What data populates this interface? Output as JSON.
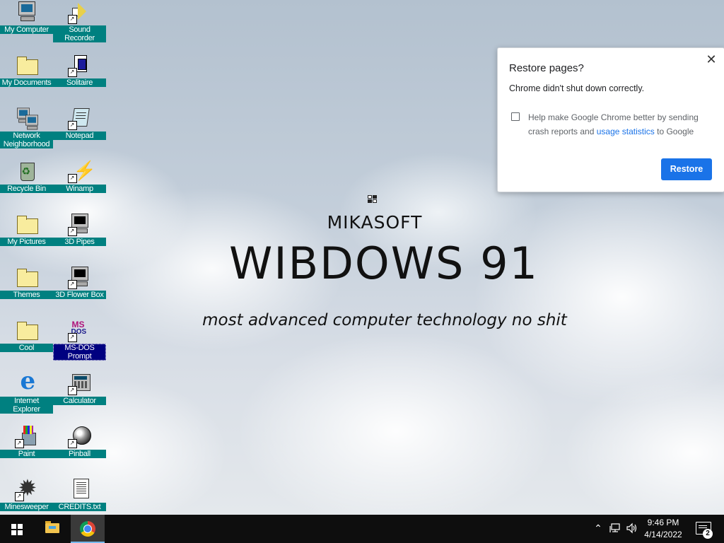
{
  "desktop": {
    "icons": [
      {
        "label": "My Computer",
        "glyph": "monitor"
      },
      {
        "label": "Sound Recorder",
        "glyph": "speaker",
        "shortcut": true
      },
      {
        "label": "My Documents",
        "glyph": "folder"
      },
      {
        "label": "Solitaire",
        "glyph": "cards",
        "shortcut": true
      },
      {
        "label": "Network Neighborhood",
        "glyph": "network"
      },
      {
        "label": "Notepad",
        "glyph": "notepad",
        "shortcut": true
      },
      {
        "label": "Recycle Bin",
        "glyph": "bin"
      },
      {
        "label": "Winamp",
        "glyph": "bolt",
        "shortcut": true
      },
      {
        "label": "My Pictures",
        "glyph": "folder"
      },
      {
        "label": "3D Pipes",
        "glyph": "monitor-dark",
        "shortcut": true
      },
      {
        "label": "Themes",
        "glyph": "folder"
      },
      {
        "label": "3D Flower Box",
        "glyph": "monitor-dark",
        "shortcut": true
      },
      {
        "label": "Cool",
        "glyph": "folder"
      },
      {
        "label": "MS-DOS Prompt",
        "glyph": "msdos",
        "shortcut": true,
        "selected": true
      },
      {
        "label": "Internet Explorer",
        "glyph": "ie"
      },
      {
        "label": "Calculator",
        "glyph": "calc",
        "shortcut": true
      },
      {
        "label": "Paint",
        "glyph": "paint",
        "shortcut": true
      },
      {
        "label": "Pinball",
        "glyph": "ball",
        "shortcut": true
      },
      {
        "label": "Minesweeper",
        "glyph": "gear",
        "shortcut": true
      },
      {
        "label": "CREDITS.txt",
        "glyph": "doc"
      }
    ],
    "brand": "MIKASOFT",
    "product": "WIBDOWS 91",
    "tagline": "most advanced computer technology no shit"
  },
  "dialog": {
    "title": "Restore pages?",
    "message": "Chrome didn't shut down correctly.",
    "checkbox_text_1": "Help make Google Chrome better by sending crash reports and",
    "checkbox_link": "usage statistics",
    "checkbox_text_2": "to Google",
    "checked": false,
    "restore_label": "Restore",
    "close_icon": "close-icon"
  },
  "taskbar": {
    "start_icon": "windows-logo-icon",
    "apps": [
      {
        "name": "File Explorer",
        "icon": "file-explorer-icon",
        "active": false
      },
      {
        "name": "Google Chrome",
        "icon": "chrome-icon",
        "active": true
      }
    ],
    "tray_icons": [
      "chevron-up-icon",
      "network-icon",
      "volume-icon"
    ],
    "time": "9:46 PM",
    "date": "4/14/2022",
    "notifications": "2"
  },
  "colors": {
    "icon_label_bg": "#008080",
    "selected_label_bg": "#000080",
    "chrome_blue": "#1a73e8",
    "taskbar_bg": "#0e0e0e"
  }
}
